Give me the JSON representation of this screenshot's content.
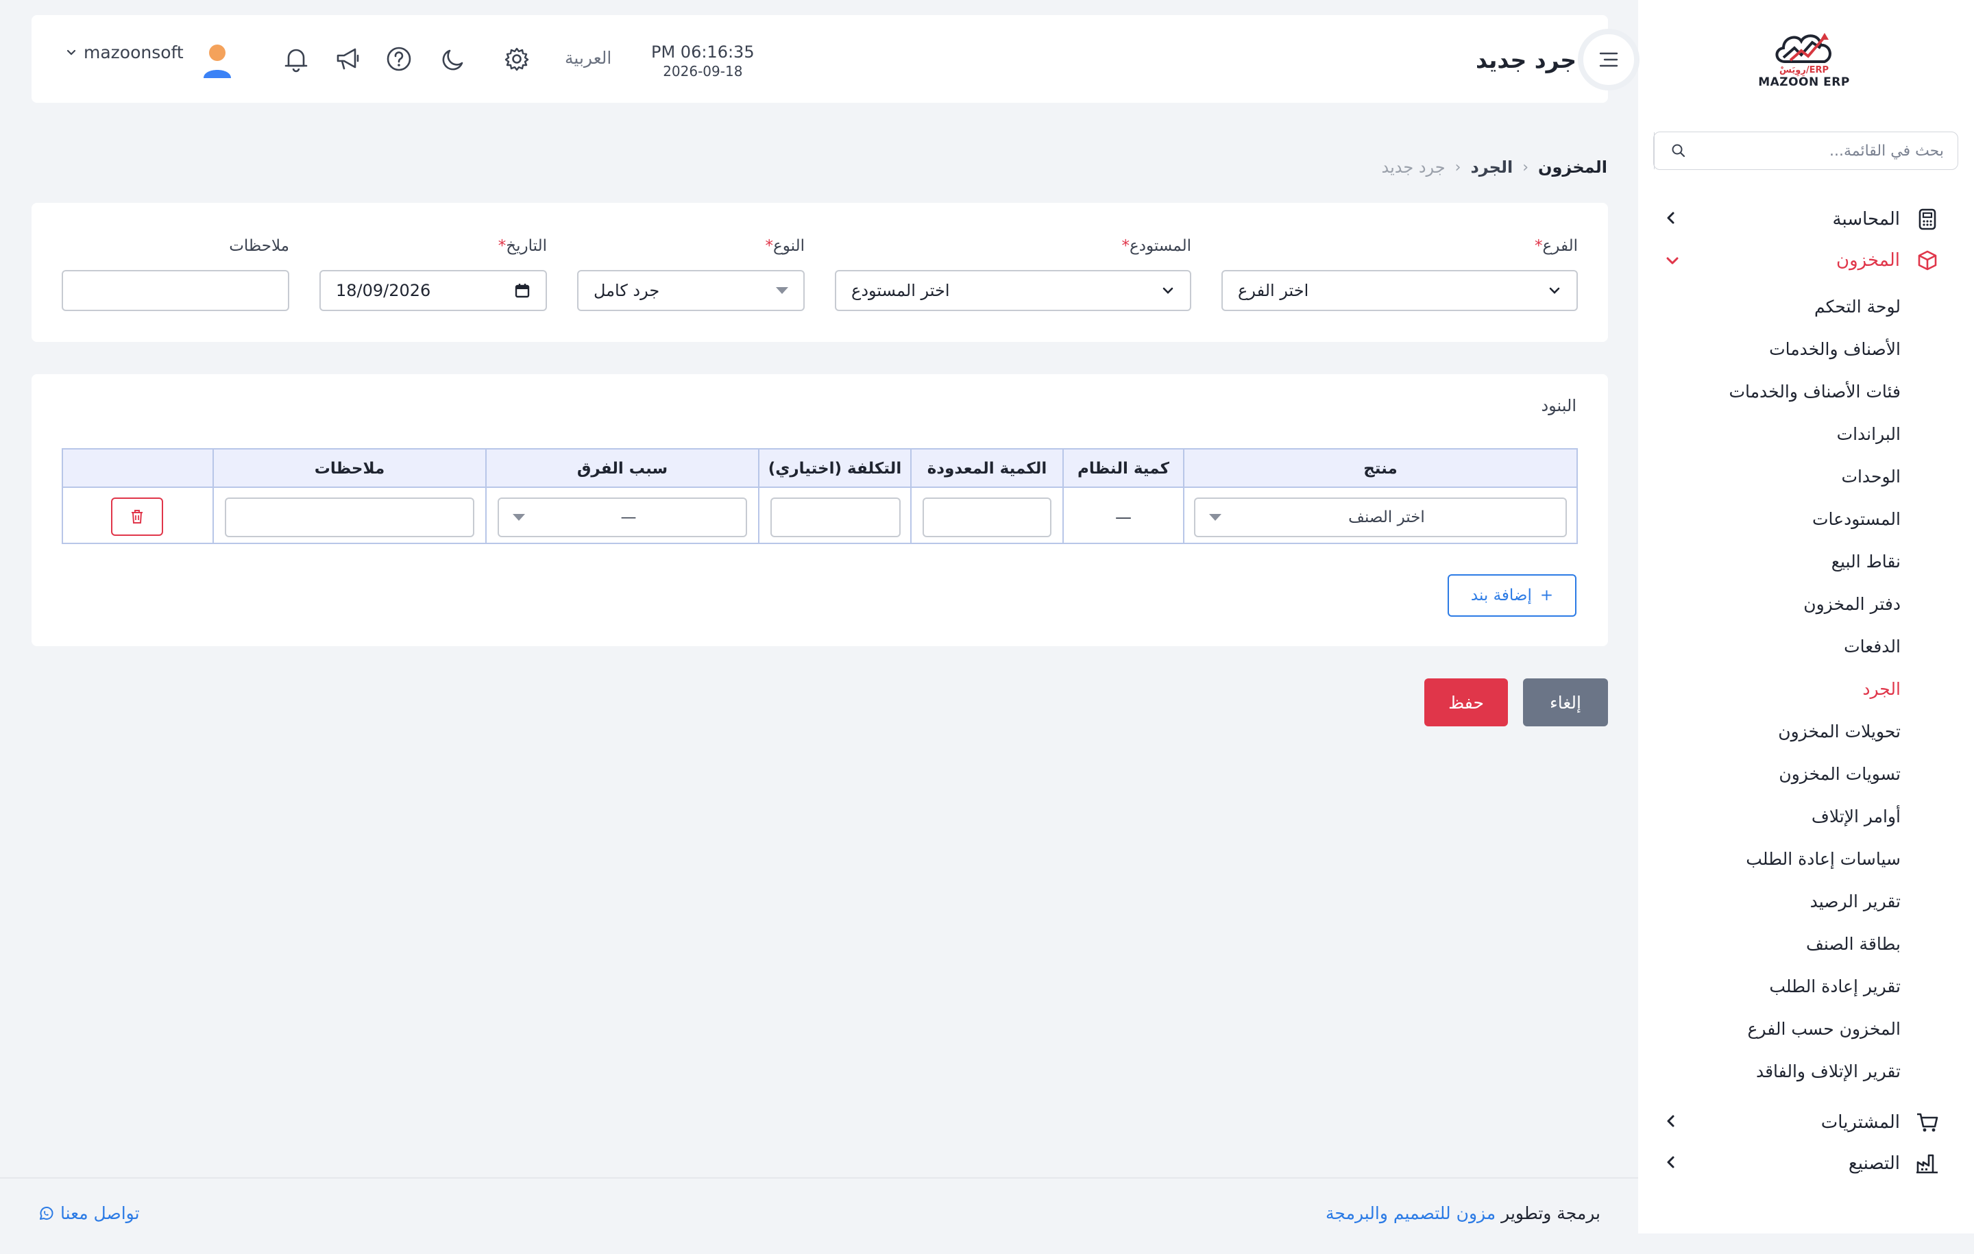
{
  "sidebar": {
    "logo_sub": "ERP/رِوِيَسْ",
    "logo_text": "MAZOON ERP",
    "search_placeholder": "بحث في القائمة...",
    "groups": [
      {
        "label": "المحاسبة"
      },
      {
        "label": "المخزون"
      },
      {
        "label": "المشتريات"
      },
      {
        "label": "التصنيع"
      }
    ],
    "inventory_items": [
      "لوحة التحكم",
      "الأصناف والخدمات",
      "فئات الأصناف والخدمات",
      "البراندات",
      "الوحدات",
      "المستودعات",
      "نقاط البيع",
      "دفتر المخزون",
      "الدفعات",
      "الجرد",
      "تحويلات المخزون",
      "تسويات المخزون",
      "أوامر الإتلاف",
      "سياسات إعادة الطلب",
      "تقرير الرصيد",
      "بطاقة الصنف",
      "تقرير إعادة الطلب",
      "المخزون حسب الفرع",
      "تقرير الإتلاف والفاقد"
    ],
    "active_item": "الجرد"
  },
  "header": {
    "title": "جرد جديد",
    "time": "PM 06:16:35",
    "date": "2026-09-18",
    "language": "العربية",
    "username": "mazoonsoft"
  },
  "breadcrumb": {
    "level1": "المخزون",
    "level2": "الجرد",
    "level3": "جرد جديد",
    "separator": "‹"
  },
  "form": {
    "branch": {
      "label": "الفرع",
      "value": "اختر الفرع"
    },
    "warehouse": {
      "label": "المستودع",
      "value": "اختر المستودع"
    },
    "type": {
      "label": "النوع",
      "value": "جرد كامل"
    },
    "date": {
      "label": "التاريخ",
      "value": "18/09/2026"
    },
    "notes": {
      "label": "ملاحظات",
      "value": ""
    },
    "required_mark": "*"
  },
  "items": {
    "title": "البنود",
    "columns": [
      "منتج",
      "كمية النظام",
      "الكمية المعدودة",
      "التكلفة (اختياري)",
      "سبب الفرق",
      "ملاحظات"
    ],
    "row": {
      "product_placeholder": "اختر الصنف",
      "system_qty": "—",
      "reason": "—"
    },
    "add_label": "إضافة بند",
    "add_symbol": "+"
  },
  "actions": {
    "cancel": "إلغاء",
    "save": "حفظ"
  },
  "footer": {
    "credit_prefix": "برمجة وتطوير",
    "credit_link": "مزون للتصميم والبرمجة",
    "contact": "تواصل معنا"
  },
  "colors": {
    "accent": "#e0364a",
    "link": "#2c7be5",
    "cancel": "#6b7587"
  }
}
